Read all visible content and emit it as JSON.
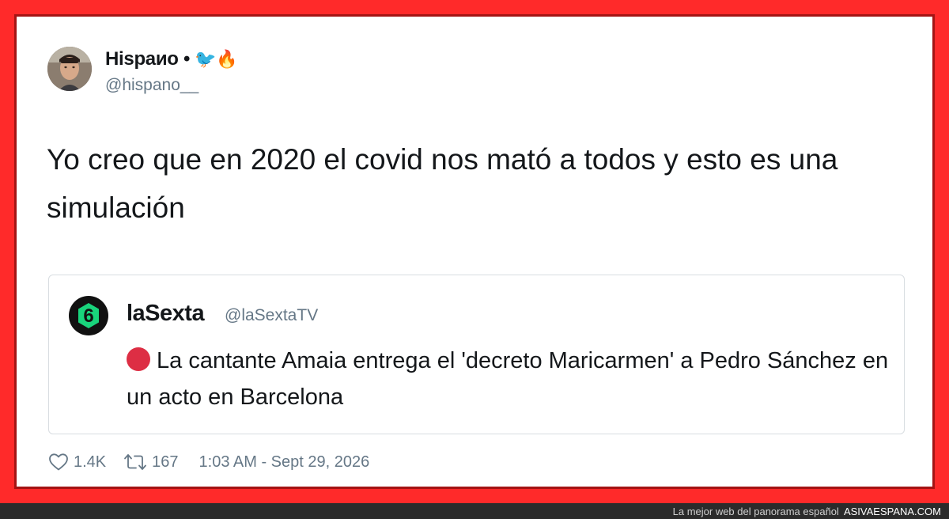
{
  "tweet": {
    "author_name": "Hispaиo •",
    "author_emojis": "🐦🔥",
    "author_handle": "@hispano__",
    "text": "Yo creo que en 2020 el covid nos mató a todos y esto es una simulación",
    "likes": "1.4K",
    "retweets": "167",
    "timestamp": "1:03 AM - Sept 29, 2026"
  },
  "quoted_tweet": {
    "author_name": "laSexta",
    "author_handle": "@laSextaTV",
    "logo_digit": "6",
    "text": "La cantante Amaia entrega el 'decreto Maricarmen' a Pedro Sánchez en un acto en Barcelona"
  },
  "watermark": {
    "tagline": "La mejor web del panorama español",
    "site": "ASIVAESPANA.COM"
  },
  "icons": {
    "like": "heart-icon",
    "retweet": "retweet-icon",
    "breaking": "red-circle-icon",
    "logo": "lasexta-logo"
  },
  "colors": {
    "frame": "#ff2a2a",
    "text": "#14171a",
    "secondary": "#657786",
    "logo_green": "#19d47c",
    "breaking_dot": "#dd2e44"
  }
}
